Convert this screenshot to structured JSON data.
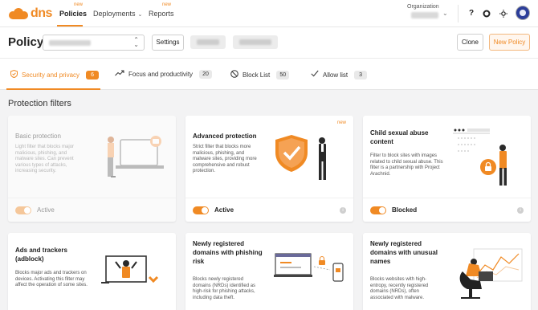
{
  "colors": {
    "accent": "#f08a24",
    "text": "#222222",
    "bg": "#f3f3f4"
  },
  "topnav": {
    "logo_text": "dns",
    "items": [
      {
        "label": "Policies",
        "badge": "new"
      },
      {
        "label": "Deployments"
      },
      {
        "label": "Reports",
        "badge": "new"
      }
    ],
    "org_label": "Organization",
    "icons": [
      "help-icon",
      "settings-icon",
      "theme-icon",
      "avatar"
    ]
  },
  "policy": {
    "title": "Policy",
    "settings_label": "Settings",
    "clone_label": "Clone",
    "new_policy_label": "New Policy"
  },
  "tabs": [
    {
      "label": "Security and privacy",
      "count": "6",
      "icon": "shield-icon"
    },
    {
      "label": "Focus and productivity",
      "count": "20",
      "icon": "trend-icon"
    },
    {
      "label": "Block List",
      "count": "50",
      "icon": "block-icon"
    },
    {
      "label": "Allow list",
      "count": "3",
      "icon": "check-icon"
    }
  ],
  "section_title": "Protection filters",
  "cards": [
    {
      "title": "Basic protection",
      "desc": "Light filter that blocks major malicious, phishing, and malware sites. Can prevent various types of attacks, increasing security.",
      "status": "Active"
    },
    {
      "title": "Advanced protection",
      "badge": "new",
      "desc": "Strict filter that blocks more malicious, phishing, and malware sites, providing more comprehensive and robust protection.",
      "status": "Active"
    },
    {
      "title": "Child sexual abuse content",
      "desc": "Filter to block sites with images related to child sexual abuse. This filter is a partnership with Project Arachnid.",
      "status": "Blocked"
    },
    {
      "title": "Ads and trackers (adblock)",
      "desc": "Blocks major ads and trackers on devices. Activating this filter may affect the operation of some sites."
    },
    {
      "title": "Newly registered domains with phishing risk",
      "desc": "Blocks newly registered domains (NRDs) identified as high-risk for phishing attacks, including data theft."
    },
    {
      "title": "Newly registered domains with unusual names",
      "desc": "Blocks websites with high-entropy, recently registered domains (NRDs), often associated with malware."
    }
  ]
}
